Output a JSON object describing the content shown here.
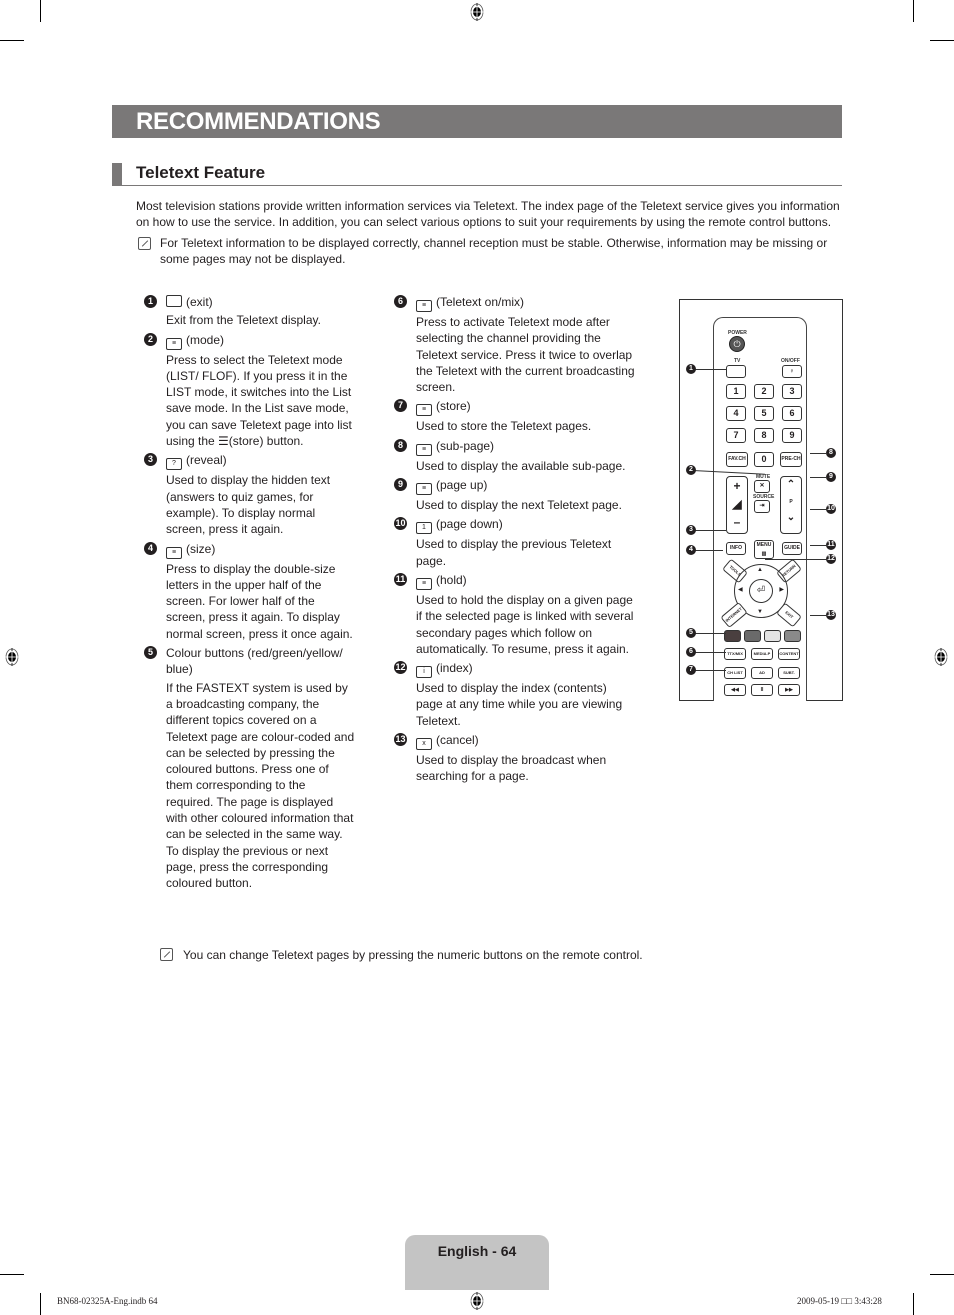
{
  "header": {
    "chapter_title": "RECOMMENDATIONS",
    "section_title": "Teletext Feature"
  },
  "intro": {
    "paragraph": "Most television stations provide written information services via Teletext. The index page of the Teletext service gives you information on how to use the service. In addition, you can select various options to suit your requirements by using the remote control buttons.",
    "note": "For Teletext information to be displayed correctly, channel reception must be stable. Otherwise, information may be missing or some pages may not be displayed."
  },
  "left_items": [
    {
      "num": "1",
      "icon": "tv-exit-icon",
      "head": "(exit)",
      "desc": "Exit from the Teletext display."
    },
    {
      "num": "2",
      "icon": "mode-icon",
      "head": "(mode)",
      "desc": "Press to select the Teletext mode (LIST/ FLOF). If you press it in the LIST mode, it switches into the List save mode. In the List save mode, you can save Teletext page into list using the ☰(store) button."
    },
    {
      "num": "3",
      "icon": "reveal-icon",
      "head": "(reveal)",
      "desc": "Used to display the hidden text (answers to quiz games, for example). To display normal screen, press it again."
    },
    {
      "num": "4",
      "icon": "size-icon",
      "head": "(size)",
      "desc": "Press to display the double-size letters in the upper half of the screen. For lower half of the screen, press it again. To display normal screen, press it once again."
    },
    {
      "num": "5",
      "icon": "",
      "head": "Colour buttons (red/green/yellow/ blue)",
      "desc": "If the FASTEXT system is used by a broadcasting company, the different topics covered on a Teletext page are colour-coded and can be selected by pressing the coloured buttons. Press one of them corresponding to the required. The page is displayed with other coloured information that can be selected in the same way. To display the previous or next page, press the corresponding coloured button."
    }
  ],
  "right_items": [
    {
      "num": "6",
      "icon": "teletext-mix-icon",
      "head": "(Teletext on/mix)",
      "desc": "Press to activate Teletext mode after selecting the channel providing the Teletext service. Press it twice to overlap the Teletext with the current broadcasting screen."
    },
    {
      "num": "7",
      "icon": "store-icon",
      "head": "(store)",
      "desc": "Used to store the Teletext pages."
    },
    {
      "num": "8",
      "icon": "sub-page-icon",
      "head": "(sub-page)",
      "desc": "Used to display the available sub-page."
    },
    {
      "num": "9",
      "icon": "page-up-icon",
      "head": "(page up)",
      "desc": "Used to display the next Teletext page."
    },
    {
      "num": "10",
      "icon": "page-down-icon",
      "head": "(page down)",
      "desc": "Used to display the previous Teletext page."
    },
    {
      "num": "11",
      "icon": "hold-icon",
      "head": "(hold)",
      "desc": "Used to hold the display on a given page if the selected page is linked with several secondary pages which follow on automatically. To resume, press it again."
    },
    {
      "num": "12",
      "icon": "index-icon",
      "head": "(index)",
      "desc": "Used to display the index (contents) page at any time while you are viewing Teletext."
    },
    {
      "num": "13",
      "icon": "cancel-icon",
      "head": "(cancel)",
      "desc": "Used to display the broadcast when searching for a page."
    }
  ],
  "bottom_note": "You can change Teletext pages by pressing the numeric buttons on the remote control.",
  "remote": {
    "power_label": "POWER",
    "tv_label": "TV",
    "onoff_label": "ON/OFF",
    "digits": [
      "1",
      "2",
      "3",
      "4",
      "5",
      "6",
      "7",
      "8",
      "9"
    ],
    "zero": "0",
    "fav_ch": "FAV.CH",
    "pre_ch": "PRE-CH",
    "mute": "MUTE",
    "source": "SOURCE",
    "p_label": "P",
    "info": "INFO",
    "menu": "MENU",
    "guide": "GUIDE",
    "tools": "TOOLS",
    "return": "RETURN",
    "internet": "INTERNET",
    "exit": "EXIT",
    "ttx_mix": "TTX/MIX",
    "media_p": "MEDIA.P",
    "content": "CONTENT",
    "ch_list": "CH LIST",
    "ad": "AD",
    "subt": "SUBT.",
    "rew": "◀◀",
    "pause": "II",
    "ff": "▶▶",
    "colors": [
      "#4a3f3f",
      "#6a6a6a",
      "#e4e4e4",
      "#8a8a8a"
    ],
    "callouts": [
      "1",
      "2",
      "3",
      "4",
      "5",
      "6",
      "7",
      "8",
      "9",
      "10",
      "11",
      "12",
      "13"
    ]
  },
  "footer": {
    "page_label": "English - 64",
    "file_info": "BN68-02325A-Eng.indb   64",
    "timestamp": "2009-05-19   □□ 3:43:28"
  }
}
